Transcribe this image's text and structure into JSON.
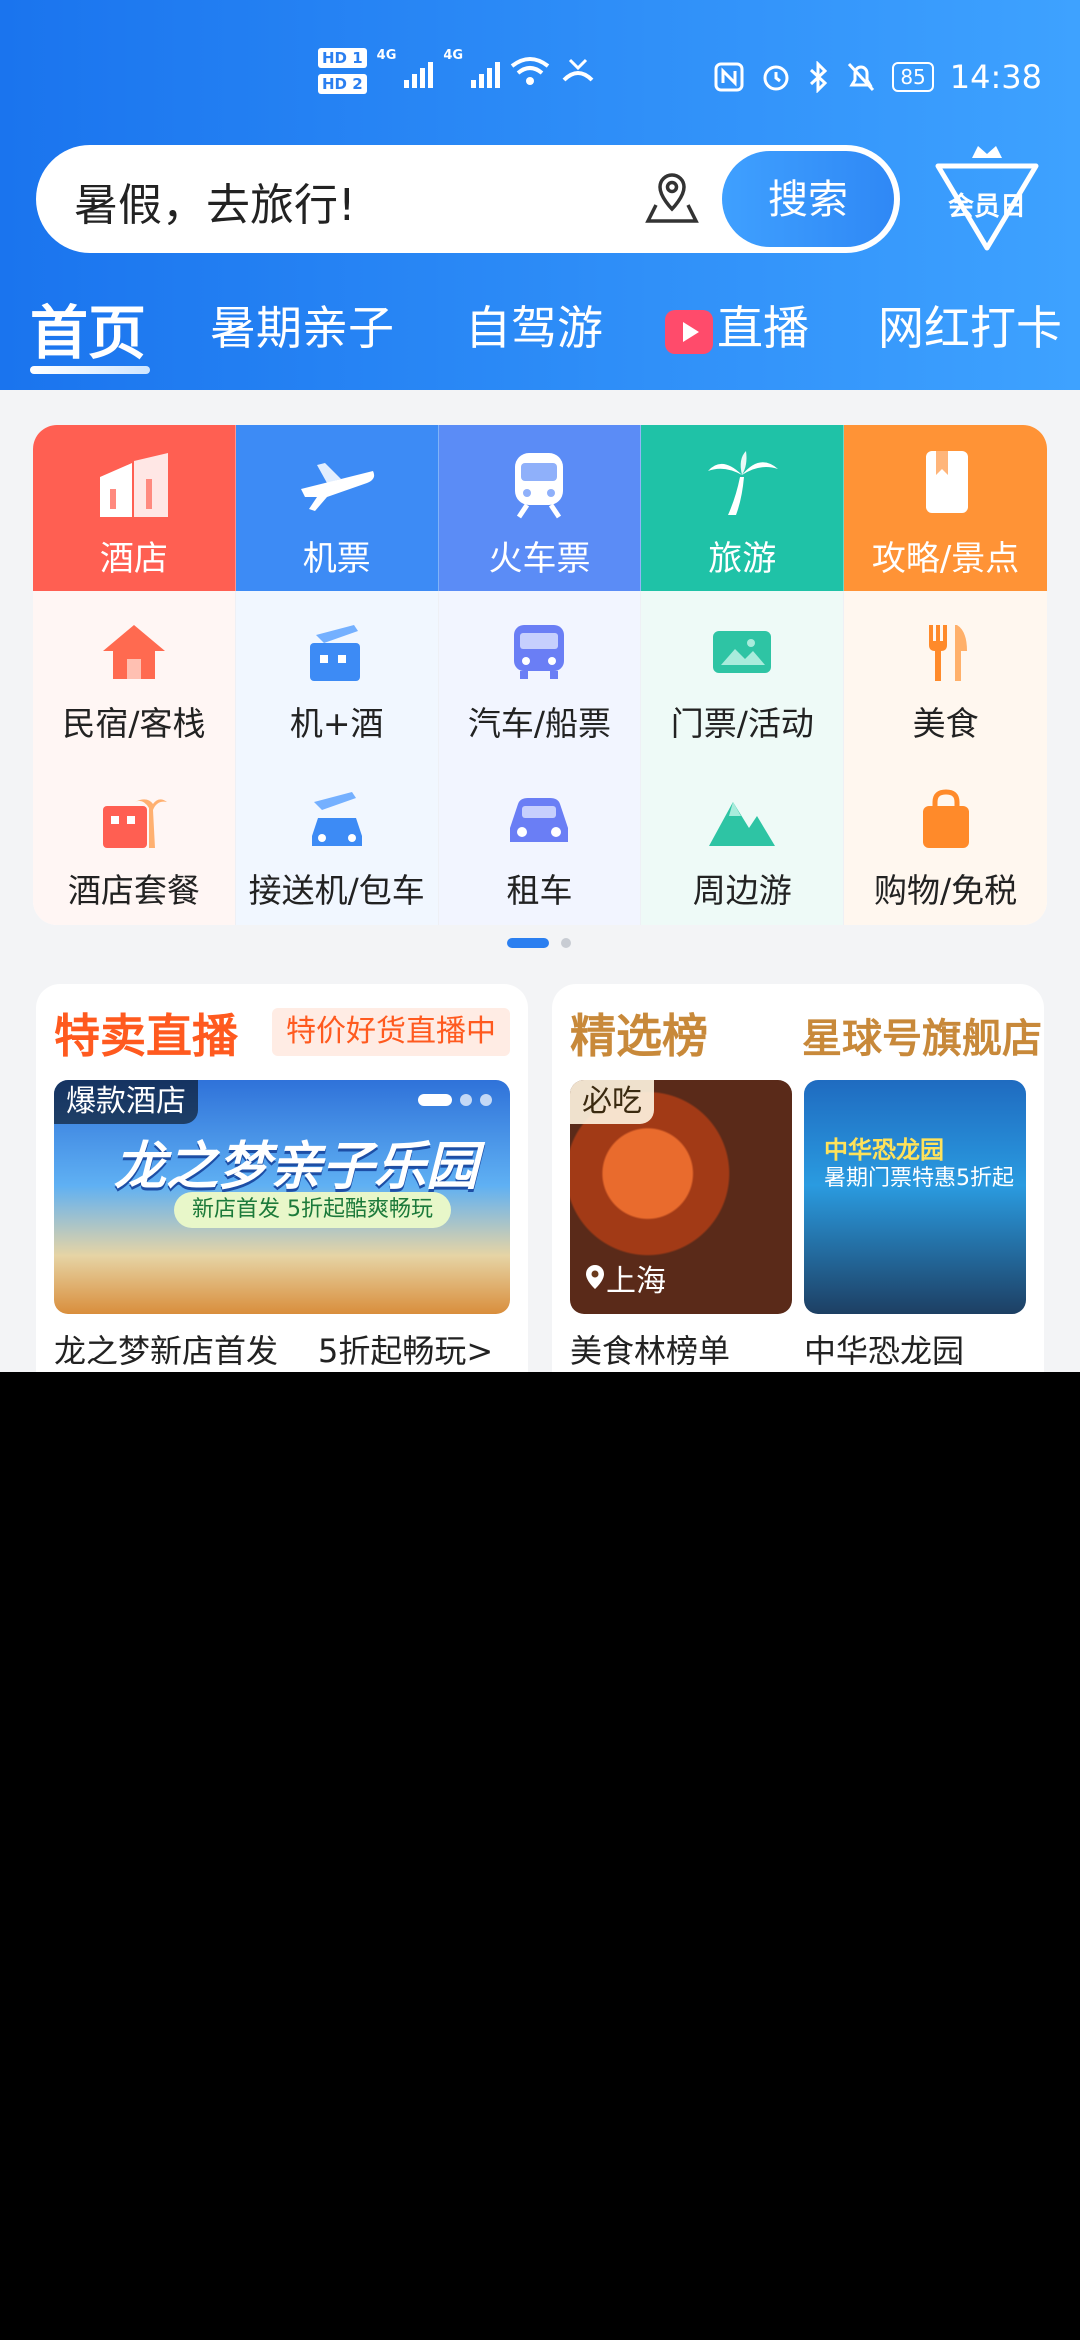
{
  "status_bar": {
    "hd1": "HD 1",
    "hd2": "HD 2",
    "net1": "4G",
    "net2": "4G",
    "battery": "85",
    "time": "14:38"
  },
  "search": {
    "placeholder": "暑假，去旅行!",
    "button": "搜索"
  },
  "vip": {
    "label": "会员日"
  },
  "tabs": [
    {
      "label": "首页"
    },
    {
      "label": "暑期亲子"
    },
    {
      "label": "自驾游"
    },
    {
      "label": "直播"
    },
    {
      "label": "网红打卡"
    }
  ],
  "grid": {
    "main": [
      {
        "label": "酒店",
        "icon": "hotel-icon",
        "color": "#ff5f52"
      },
      {
        "label": "机票",
        "icon": "plane-icon",
        "color": "#3d8bf5"
      },
      {
        "label": "火车票",
        "icon": "train-icon",
        "color": "#5b8cf6"
      },
      {
        "label": "旅游",
        "icon": "palm-tree-icon",
        "color": "#1fc2a7"
      },
      {
        "label": "攻略/景点",
        "icon": "guide-book-icon",
        "color": "#ff9336"
      }
    ],
    "row2": [
      {
        "label": "民宿/客栈",
        "icon": "house-icon"
      },
      {
        "label": "机+酒",
        "icon": "flight-hotel-icon"
      },
      {
        "label": "汽车/船票",
        "icon": "bus-icon"
      },
      {
        "label": "门票/活动",
        "icon": "ticket-icon"
      },
      {
        "label": "美食",
        "icon": "food-icon"
      }
    ],
    "row3": [
      {
        "label": "酒店套餐",
        "icon": "hotel-package-icon"
      },
      {
        "label": "接送机/包车",
        "icon": "airport-transfer-icon"
      },
      {
        "label": "租车",
        "icon": "car-rental-icon"
      },
      {
        "label": "周边游",
        "icon": "mountain-icon"
      },
      {
        "label": "购物/免税",
        "icon": "shopping-bag-icon"
      }
    ]
  },
  "cards": {
    "left": {
      "title": "特卖直播",
      "badge": "特价好货直播中",
      "banner_tag": "爆款酒店",
      "banner_title": "龙之梦亲子乐园",
      "banner_sub": "新店首发 5折起酷爽畅玩",
      "caption": "龙之梦新店首发",
      "caption2": "5折起畅玩>"
    },
    "right": {
      "title": "精选榜",
      "title2": "星球号旗舰店",
      "thumb1_tag": "必吃",
      "thumb1_loc": "上海",
      "thumb1_caption": "美食林榜单",
      "thumb2_text": "中华恐龙园",
      "thumb2_sub": "暑期门票特惠5折起",
      "thumb2_caption": "中华恐龙园"
    }
  }
}
